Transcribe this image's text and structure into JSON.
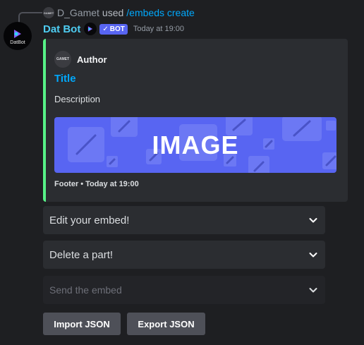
{
  "reply": {
    "avatar_text": "GAMET",
    "user": "D_Gamet",
    "used": "used",
    "command": "/embeds create"
  },
  "message": {
    "avatar_text": "DatBot",
    "bot_name": "Dat Bot",
    "badge_check": "✓",
    "badge_label": "BOT",
    "timestamp": "Today at 19:00"
  },
  "embed": {
    "accent_color": "#57f287",
    "author_icon_text": "GAMET",
    "author": "Author",
    "title": "Title",
    "description": "Description",
    "image_text": "IMAGE",
    "footer_text": "Footer",
    "footer_separator": "•",
    "footer_time": "Today at 19:00"
  },
  "dropdowns": [
    {
      "label": "Edit your embed!",
      "disabled": false
    },
    {
      "label": "Delete a part!",
      "disabled": false
    },
    {
      "label": "Send the embed",
      "disabled": true
    }
  ],
  "buttons": {
    "import": "Import JSON",
    "export": "Export JSON"
  },
  "colors": {
    "background": "#1e1f22",
    "embed_bg": "#2b2d31",
    "link": "#00a8fc",
    "bot_name": "#4ecdf2",
    "badge": "#5865f2",
    "button": "#4e5058"
  },
  "icons": [
    "chevron-down-icon",
    "verified-check-icon",
    "dat-bot-logo-icon"
  ]
}
